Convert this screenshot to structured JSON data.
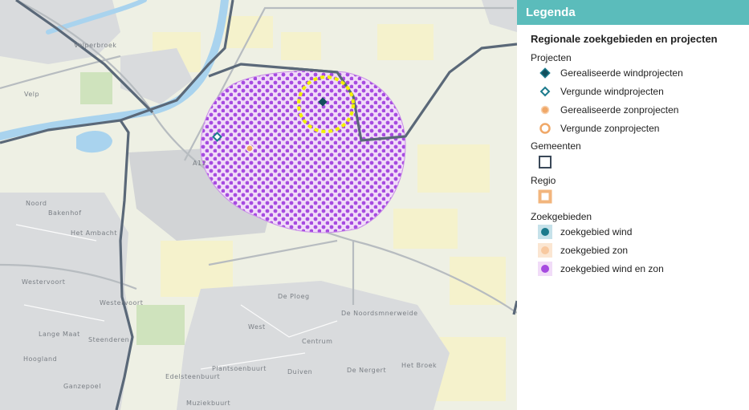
{
  "legend": {
    "header": "Legenda",
    "title": "Regionale zoekgebieden en projecten",
    "groups": [
      {
        "title": "Projecten",
        "items": [
          {
            "label": "Gerealiseerde windprojecten",
            "icon": "filled-diamond-icon"
          },
          {
            "label": "Vergunde windprojecten",
            "icon": "outline-diamond-icon"
          },
          {
            "label": "Gerealiseerde zonprojecten",
            "icon": "filled-circle-icon"
          },
          {
            "label": "Vergunde zonprojecten",
            "icon": "outline-circle-icon"
          }
        ]
      },
      {
        "title": "Gemeenten",
        "items": [
          {
            "label": "",
            "icon": "municipality-boundary-icon"
          }
        ]
      },
      {
        "title": "Regio",
        "items": [
          {
            "label": "",
            "icon": "region-boundary-icon"
          }
        ]
      },
      {
        "title": "Zoekgebieden",
        "items": [
          {
            "label": "zoekgebied wind",
            "icon": "wind-area-icon"
          },
          {
            "label": "zoekgebied zon",
            "icon": "solar-area-icon"
          },
          {
            "label": "zoekgebied wind en zon",
            "icon": "wind-solar-area-icon"
          }
        ]
      }
    ]
  },
  "map": {
    "place_labels": [
      "Velperbroek",
      "Noord",
      "Bakenhof",
      "Het Ambacht",
      "Westervoort",
      "Lange Maat",
      "Steenderen",
      "Hoogland",
      "Westervoort",
      "Ganzepoel",
      "De Ploeg",
      "De Noordsmnerweide",
      "West",
      "Centrum",
      "Plantsoenbuurt",
      "Duiven",
      "De Nergert",
      "Het Broek",
      "Edelsteenbuurt",
      "Muziekbuurt",
      "Velp"
    ],
    "road_label": "A12"
  },
  "colors": {
    "header": "#5bbcbb",
    "municipality": "#5a6878",
    "wind_solar": "#a64be0",
    "wind": "#1b7a8c",
    "solar": "#f0a868",
    "region": "#f2b57d",
    "circle_highlight": "#f2f200"
  }
}
